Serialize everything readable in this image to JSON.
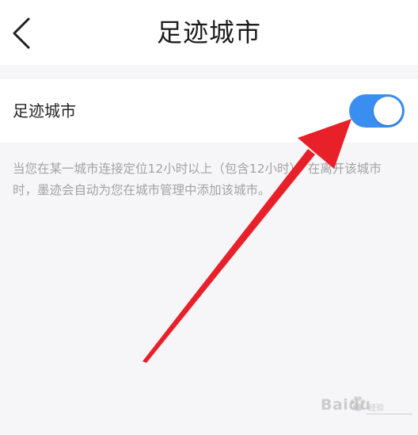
{
  "header": {
    "title": "足迹城市",
    "back_icon": "chevron-left-icon"
  },
  "setting": {
    "label": "足迹城市",
    "toggle_on": true,
    "toggle_color": "#3a8ef0"
  },
  "description": "当您在某一城市连接定位12小时以上（包含12小时），在离开该城市时，墨迹会自动为您在城市管理中添加该城市。",
  "annotation": {
    "arrow_color": "#e8202a"
  },
  "watermark": {
    "text": "Baidu",
    "sub_text": "经验"
  }
}
